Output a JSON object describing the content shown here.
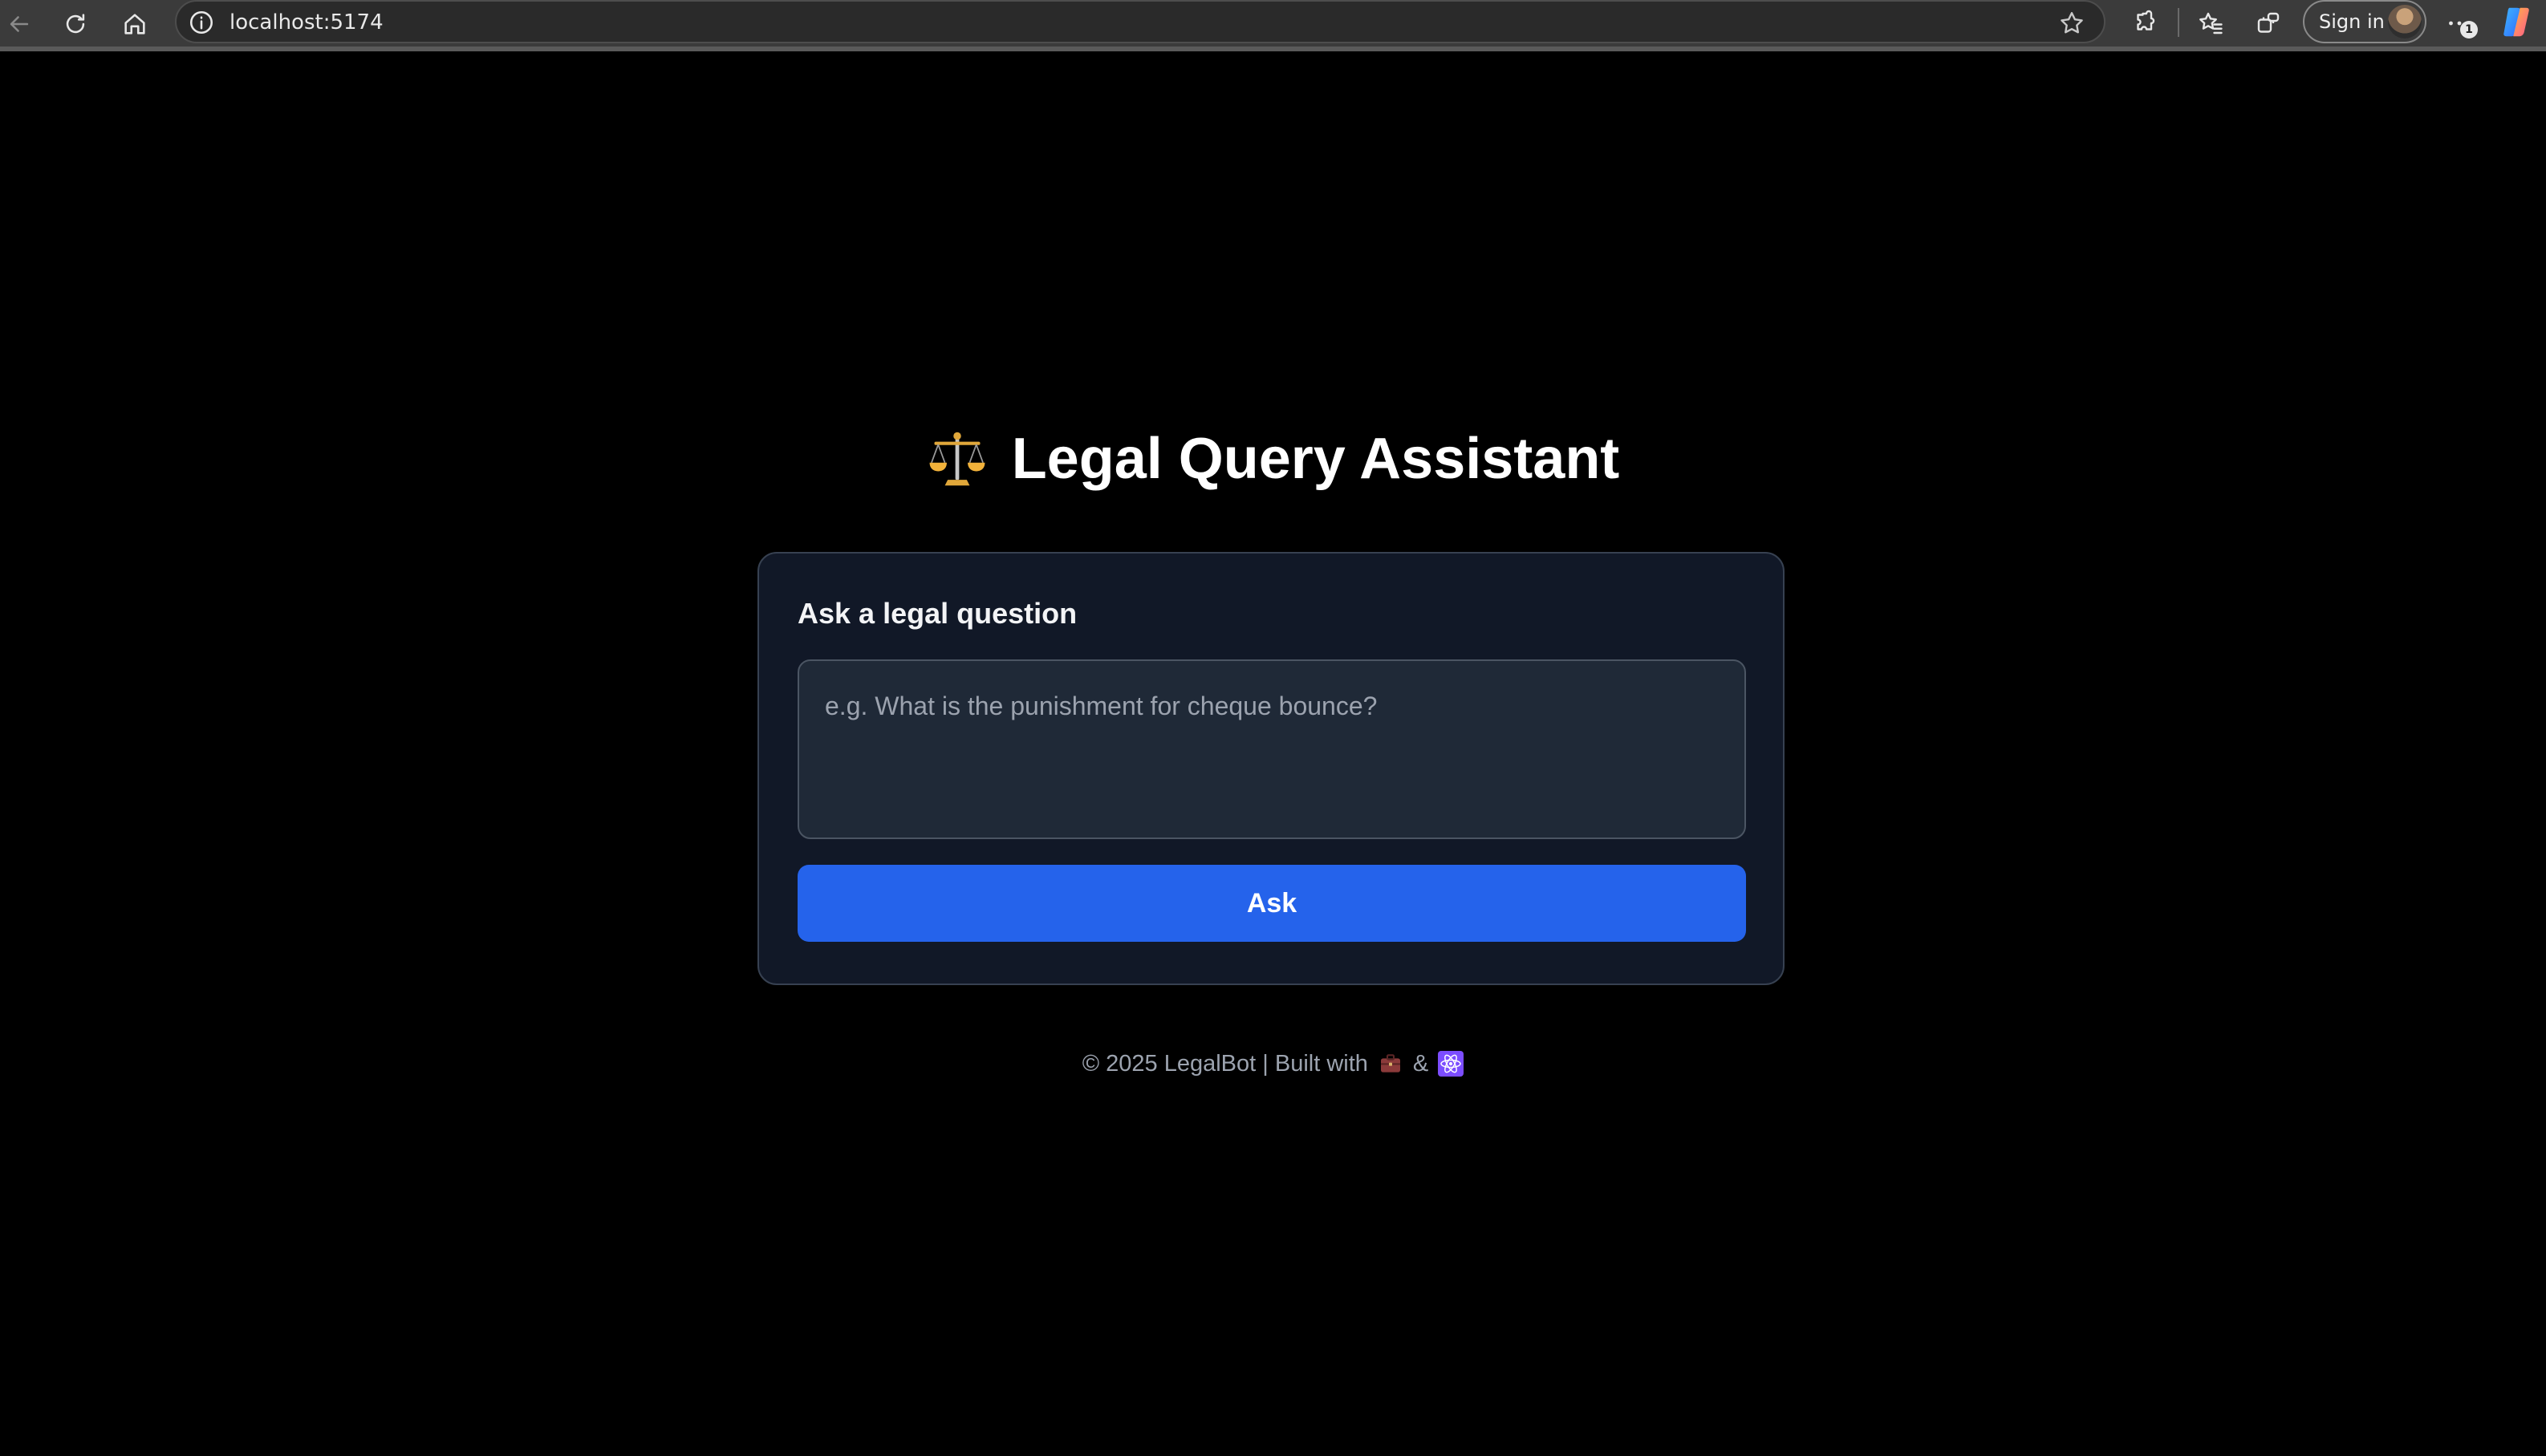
{
  "browser": {
    "url": "localhost:5174",
    "sign_in_label": "Sign in",
    "notification_badge": "1",
    "icons": {
      "back": "back-arrow-icon",
      "reload": "reload-icon",
      "home": "home-icon",
      "site_info": "info-icon",
      "favorite": "star-icon",
      "extensions": "puzzle-icon",
      "favorites": "favorites-icon",
      "collections": "collections-icon",
      "more": "more-dots-icon",
      "copilot": "copilot-icon"
    }
  },
  "app": {
    "title_icon": "scales-icon",
    "title": "Legal Query Assistant",
    "form": {
      "label": "Ask a legal question",
      "placeholder": "e.g. What is the punishment for cheque bounce?",
      "value": "",
      "submit_label": "Ask"
    },
    "footer": {
      "text": "© 2025 LegalBot | Built with",
      "separator": "&",
      "icons": [
        "briefcase-icon",
        "react-atom-icon"
      ]
    }
  },
  "colors": {
    "page_background": "#000000",
    "card_background": "#111827",
    "input_background": "#1f2937",
    "button_accent": "#2563eb",
    "title_text": "#ffffff",
    "muted_text": "#9ca3af"
  }
}
